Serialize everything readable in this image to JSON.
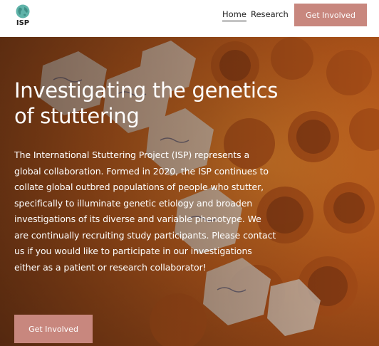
{
  "brand": {
    "logo_text": "ISP",
    "accent_color": "#c8877e"
  },
  "nav": {
    "items": [
      {
        "label": "Home",
        "active": true
      },
      {
        "label": "Research",
        "active": false
      }
    ],
    "cta_label": "Get Involved"
  },
  "hero": {
    "title": "Investigating the genetics of stuttering",
    "body": "The International Stuttering Project (ISP) represents a global collaboration. Formed in 2020, the ISP continues to collate global outbred populations of people who stutter, specifically to illuminate genetic etiology and broaden investigations of its diverse and variable phenotype. We are continually recruiting study participants. Please contact us if you would like to participate in our investigations either as a patient or research collaborator!",
    "cta_label": "Get Involved"
  }
}
